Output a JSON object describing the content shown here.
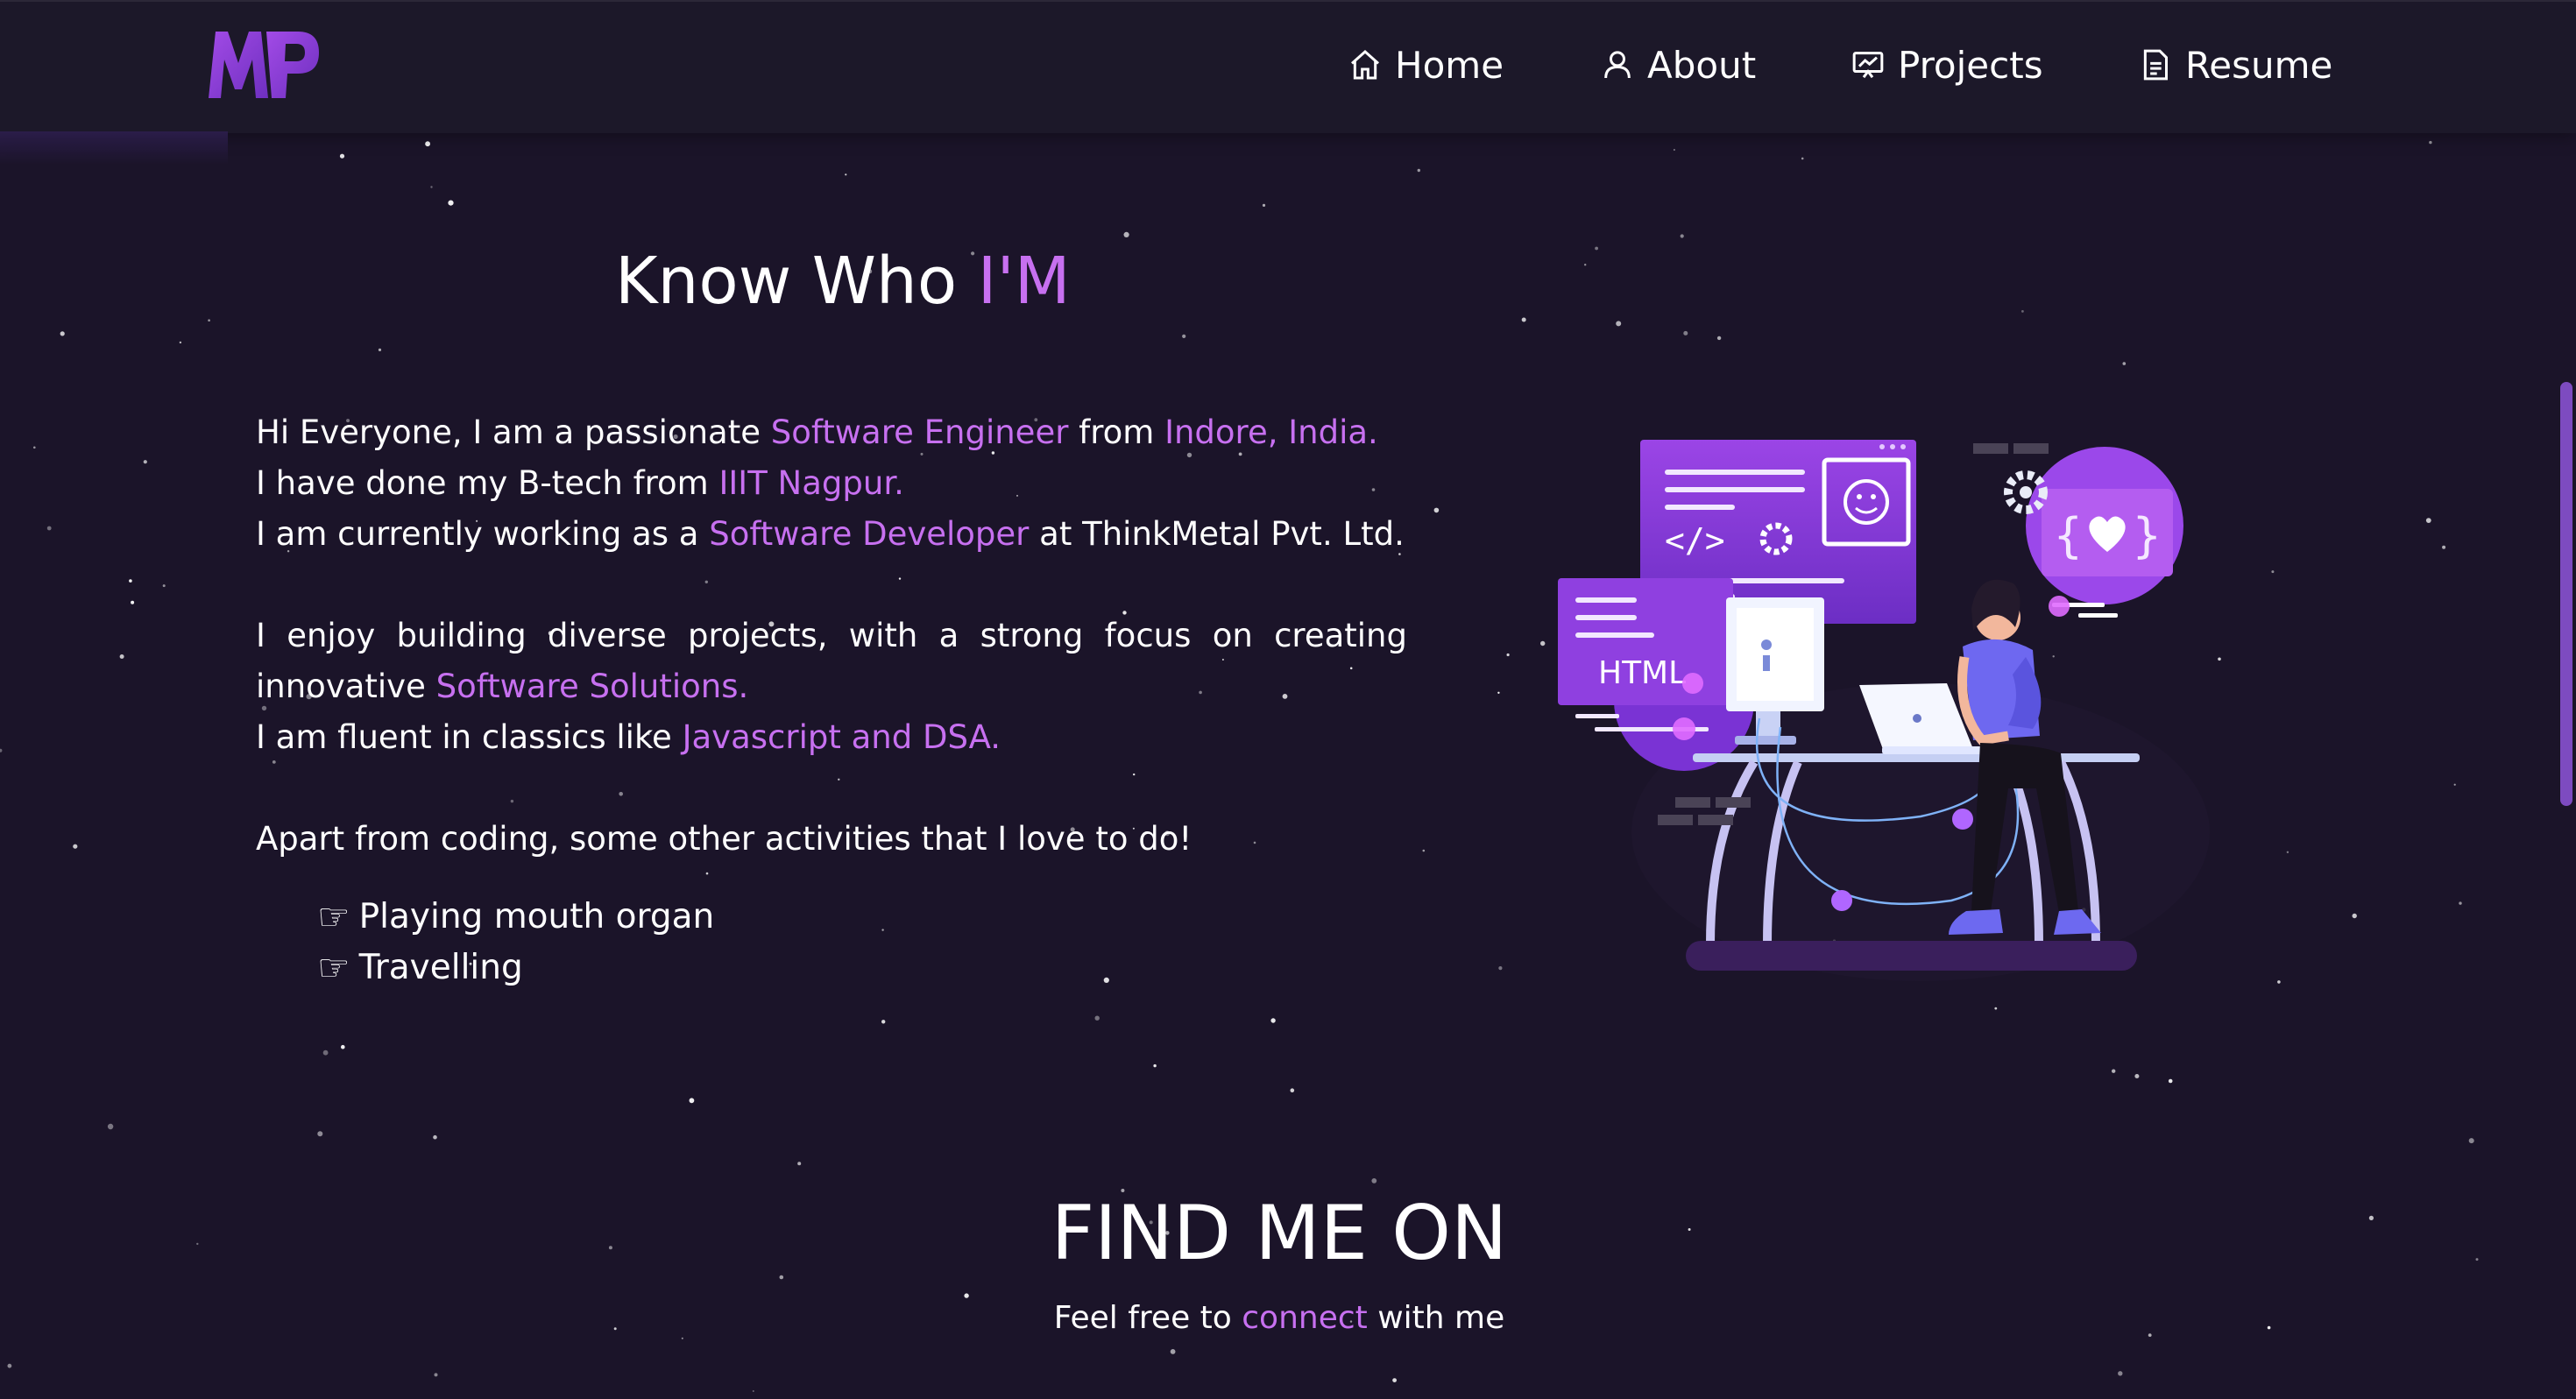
{
  "nav": {
    "logo_text": "MP",
    "items": [
      {
        "label": "Home",
        "icon": "home-icon"
      },
      {
        "label": "About",
        "icon": "user-icon"
      },
      {
        "label": "Projects",
        "icon": "projects-icon"
      },
      {
        "label": "Resume",
        "icon": "resume-icon"
      }
    ]
  },
  "about": {
    "title_main": "Know Who ",
    "title_accent": "I'M",
    "intro": {
      "line1_a": "Hi Everyone, I am a passionate ",
      "line1_b": "Software Engineer",
      "line1_c": " from ",
      "line1_d": "Indore, India.",
      "line2_a": "I have done my B-tech from ",
      "line2_b": "IIIT Nagpur.",
      "line3_a": "I am currently working as a ",
      "line3_b": "Software Developer",
      "line3_c": " at ThinkMetal Pvt. Ltd."
    },
    "projects": {
      "text_a": "I enjoy building diverse projects, with a strong focus on creating innovative ",
      "text_b": "Software Solutions.",
      "line2_a": "I am fluent in classics like ",
      "line2_b": "Javascript and DSA."
    },
    "hobbies_intro": "Apart from coding, some other activities that I love to do!",
    "activities": [
      "Playing mouth organ",
      "Travelling"
    ],
    "bullet_icon": "pointing-hand-icon"
  },
  "illustration": {
    "html_label": "HTML",
    "code_label": "</>"
  },
  "find": {
    "title": "FIND ME ON",
    "sub_a": "Feel free to ",
    "sub_b": "connect",
    "sub_c": " with me"
  },
  "colors": {
    "background": "#1b1429",
    "navbar": "#1c1829",
    "accent": "#c770f0",
    "illustration_purple": "#8a3fd8"
  }
}
